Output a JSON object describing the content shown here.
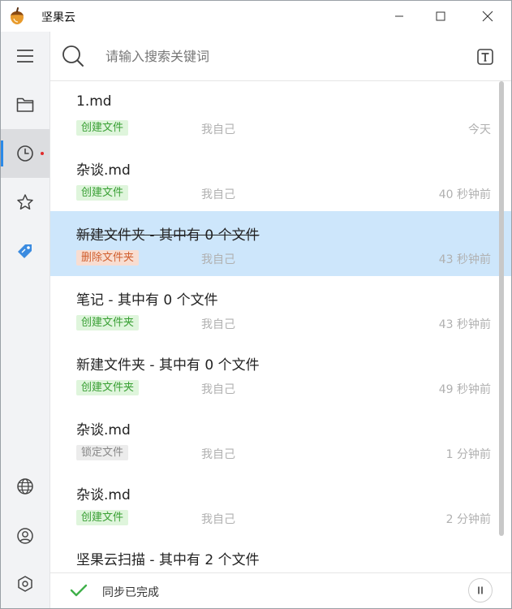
{
  "app": {
    "title": "坚果云"
  },
  "sidebar": {
    "items": [
      {
        "icon": "menu-icon"
      },
      {
        "icon": "folder-icon"
      },
      {
        "icon": "clock-icon",
        "active": true,
        "has_notification": true
      },
      {
        "icon": "star-icon"
      },
      {
        "icon": "tag-icon"
      },
      {
        "icon": "globe-icon"
      },
      {
        "icon": "user-icon"
      },
      {
        "icon": "settings-icon"
      }
    ]
  },
  "search": {
    "placeholder": "请输入搜索关键词"
  },
  "activity": [
    {
      "title": "1.md",
      "tag": "创建文件",
      "tag_color": "green",
      "user": "我自己",
      "time": "今天"
    },
    {
      "title": "杂谈.md",
      "tag": "创建文件",
      "tag_color": "green",
      "user": "我自己",
      "time": "40 秒钟前"
    },
    {
      "title": "新建文件夹 - 其中有 0 个文件",
      "tag": "删除文件夹",
      "tag_color": "orange",
      "user": "我自己",
      "time": "43 秒钟前",
      "strikethrough": true,
      "selected": true
    },
    {
      "title": "笔记 - 其中有 0 个文件",
      "tag": "创建文件夹",
      "tag_color": "green",
      "user": "我自己",
      "time": "43 秒钟前"
    },
    {
      "title": "新建文件夹 - 其中有 0 个文件",
      "tag": "创建文件夹",
      "tag_color": "green",
      "user": "我自己",
      "time": "49 秒钟前"
    },
    {
      "title": "杂谈.md",
      "tag": "锁定文件",
      "tag_color": "gray",
      "user": "我自己",
      "time": "1 分钟前"
    },
    {
      "title": "杂谈.md",
      "tag": "创建文件",
      "tag_color": "green",
      "user": "我自己",
      "time": "2 分钟前"
    },
    {
      "title": "坚果云扫描 - 其中有 2 个文件",
      "tag": "",
      "tag_color": "green",
      "user": "",
      "time": ""
    }
  ],
  "status": {
    "text": "同步已完成"
  },
  "colors": {
    "accent": "#2b8ae8",
    "selected_row": "#cde6fb",
    "tag_green_bg": "#dff5dc",
    "tag_orange_bg": "#f8ddd1"
  }
}
